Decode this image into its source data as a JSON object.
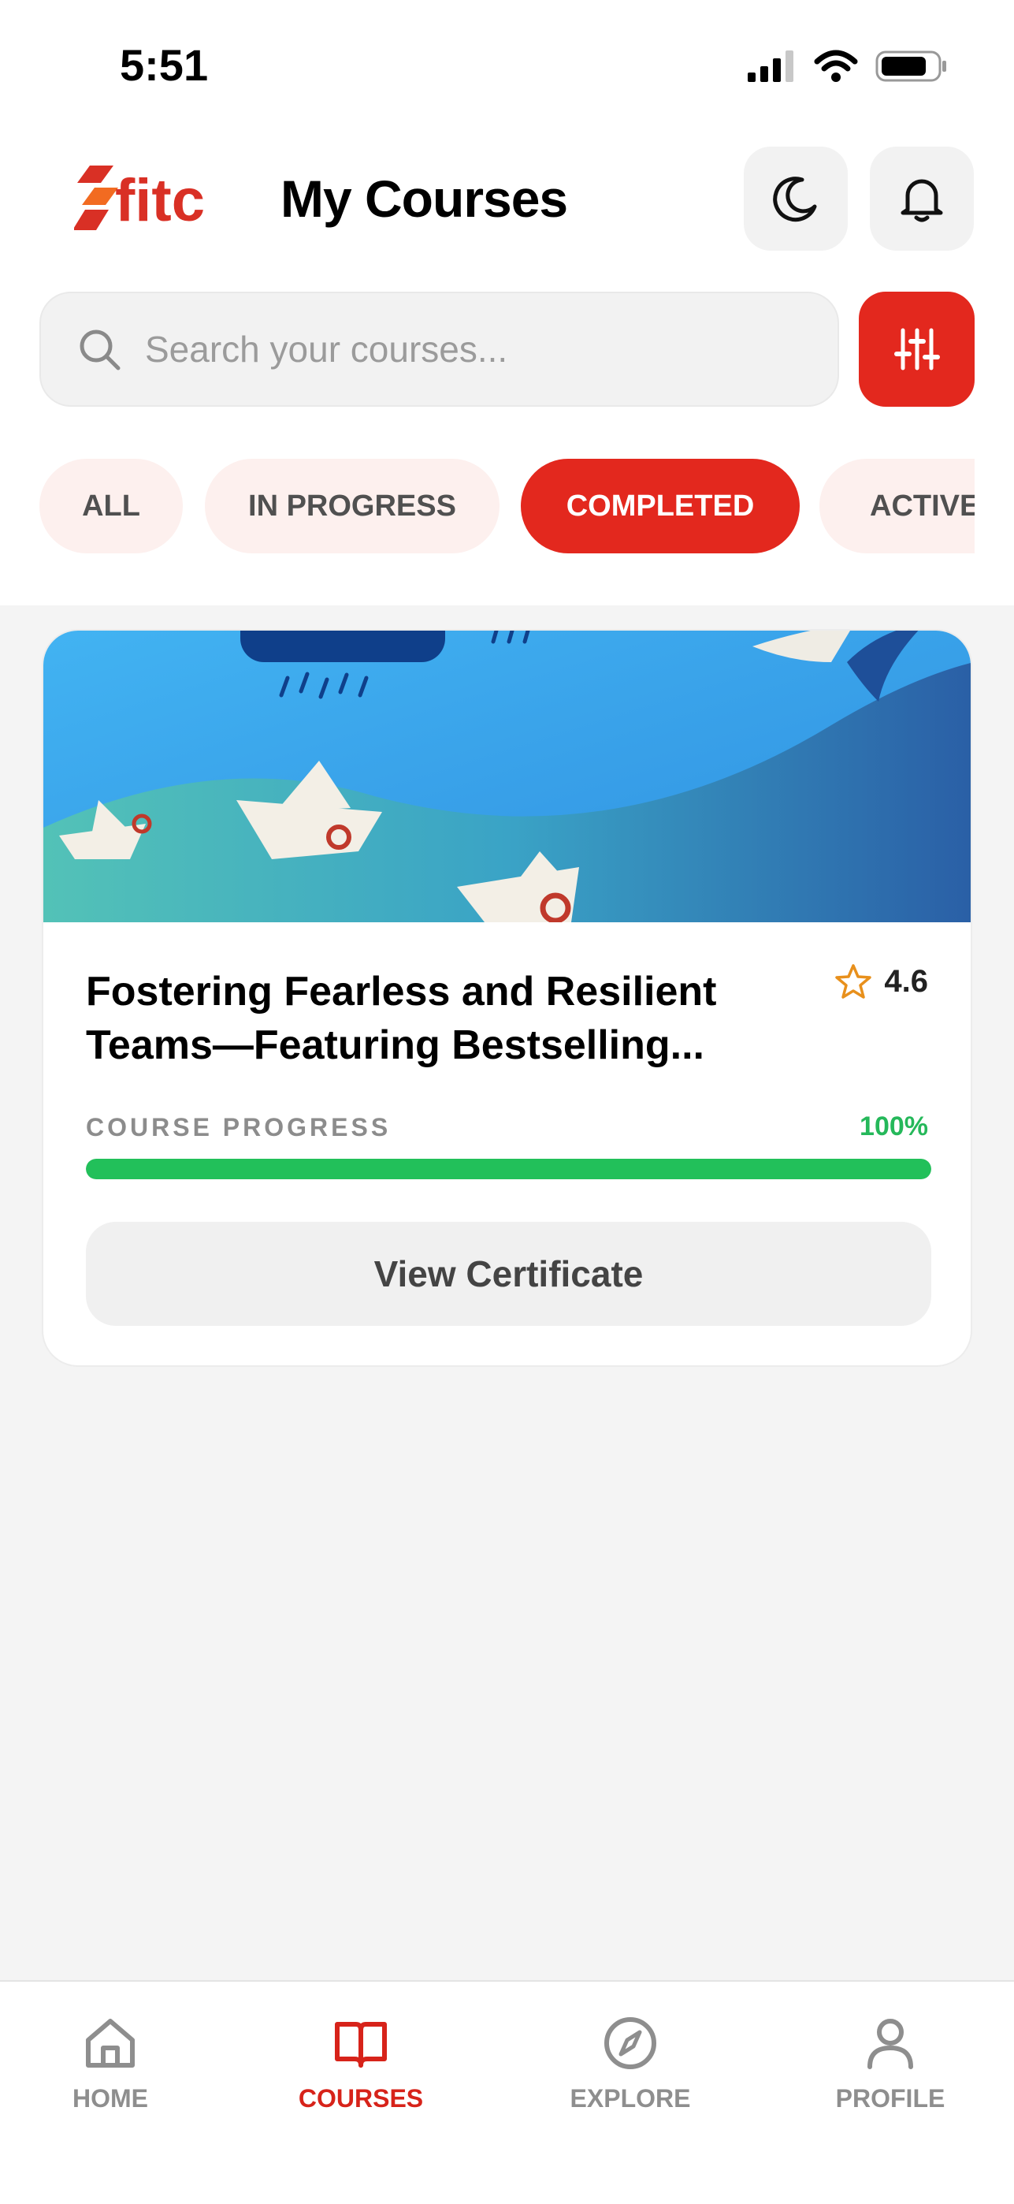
{
  "status_bar": {
    "time": "5:51"
  },
  "header": {
    "title": "My Courses",
    "logo_text": "fitc"
  },
  "search": {
    "placeholder": "Search your courses..."
  },
  "tabs": [
    {
      "label": "ALL",
      "active": false
    },
    {
      "label": "IN PROGRESS",
      "active": false
    },
    {
      "label": "COMPLETED",
      "active": true
    },
    {
      "label": "ACTIVE",
      "active": false
    }
  ],
  "course": {
    "title": "Fostering Fearless and Resilient Teams—Featuring Bestselling...",
    "rating": "4.6",
    "progress_label": "COURSE PROGRESS",
    "progress_text": "100%",
    "progress_value": 1.0,
    "button_label": "View Certificate"
  },
  "bottom_nav": [
    {
      "label": "HOME",
      "icon": "home-icon",
      "active": false
    },
    {
      "label": "COURSES",
      "icon": "book-icon",
      "active": true
    },
    {
      "label": "EXPLORE",
      "icon": "compass-icon",
      "active": false
    },
    {
      "label": "PROFILE",
      "icon": "user-icon",
      "active": false
    }
  ],
  "colors": {
    "accent": "#e3281e",
    "success": "#22c05a",
    "star": "#e8901c"
  }
}
